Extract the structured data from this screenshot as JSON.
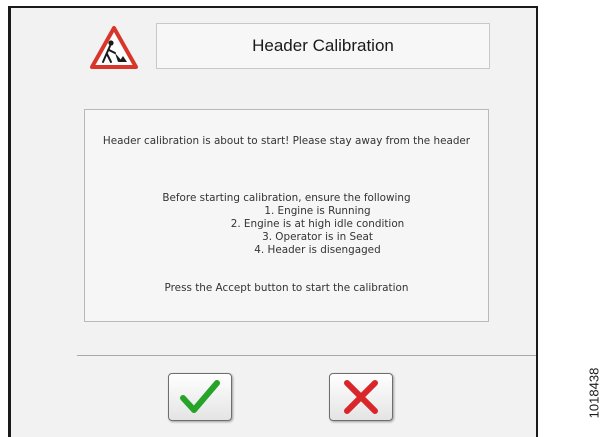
{
  "dialog": {
    "title": "Header Calibration",
    "icon": "construction-warning-icon",
    "intro": "Header calibration is about to start! Please stay away from the header",
    "checklist_heading": "Before starting calibration, ensure the following",
    "checklist": [
      "1. Engine is Running",
      "2. Engine is at high idle condition",
      "3. Operator is in Seat",
      "4. Header is disengaged"
    ],
    "footer": "Press the Accept button to start the calibration"
  },
  "buttons": {
    "accept_icon": "check-icon",
    "cancel_icon": "x-icon"
  },
  "colors": {
    "warning_red": "#d9362b",
    "accept_green": "#27a32a",
    "cancel_red": "#d8262a"
  },
  "figure_id": "1018438"
}
